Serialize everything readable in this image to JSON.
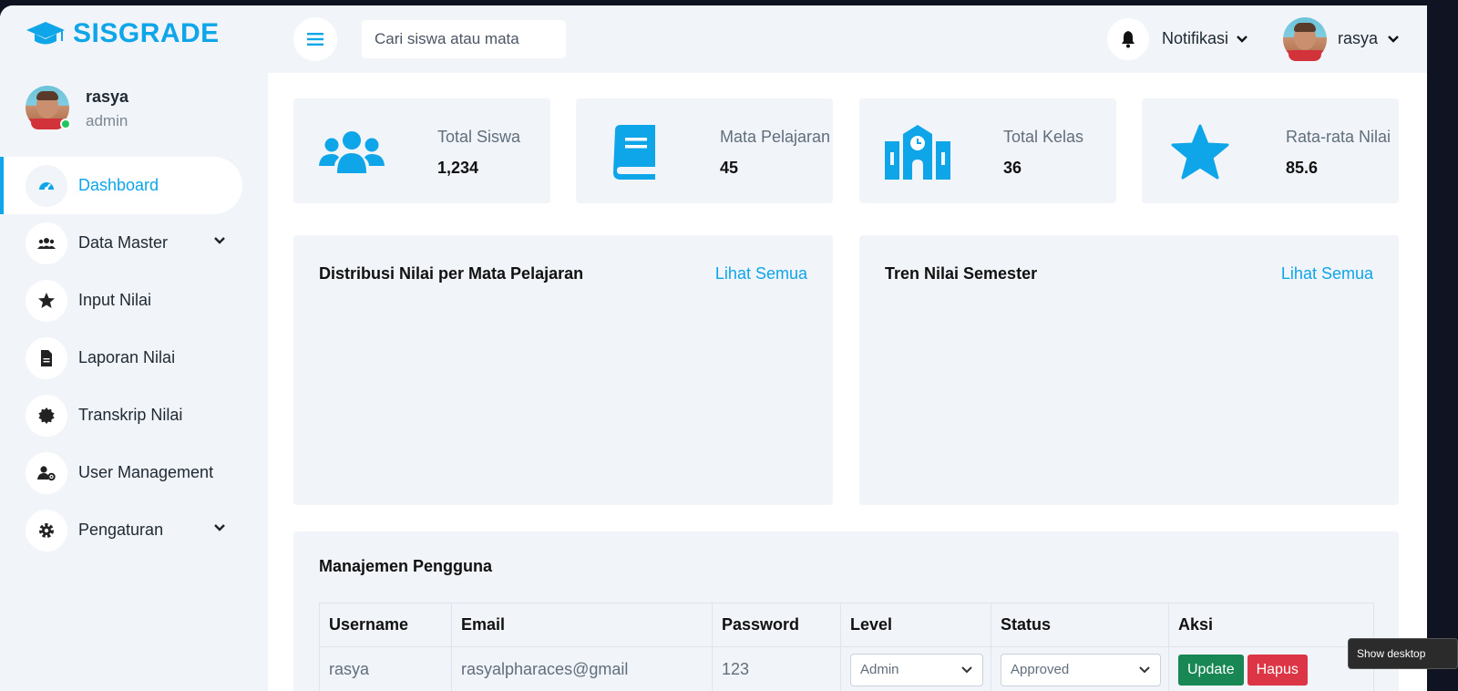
{
  "app": {
    "name": "SISGRADE",
    "accent": "#0ea5e9"
  },
  "profile": {
    "name": "rasya",
    "role": "admin",
    "status": "online"
  },
  "sidebar": {
    "items": [
      {
        "label": "Dashboard",
        "icon": "gauge-icon",
        "active": true
      },
      {
        "label": "Data Master",
        "icon": "users-icon",
        "has_submenu": true
      },
      {
        "label": "Input Nilai",
        "icon": "star-icon"
      },
      {
        "label": "Laporan Nilai",
        "icon": "file-icon"
      },
      {
        "label": "Transkrip Nilai",
        "icon": "certificate-icon"
      },
      {
        "label": "User Management",
        "icon": "user-gear-icon"
      },
      {
        "label": "Pengaturan",
        "icon": "gear-icon",
        "has_submenu": true
      }
    ]
  },
  "topbar": {
    "search_placeholder": "Cari siswa atau mata",
    "notifications_label": "Notifikasi",
    "user_label": "rasya"
  },
  "stats": [
    {
      "label": "Total Siswa",
      "value": "1,234",
      "icon": "users-icon"
    },
    {
      "label": "Mata Pelajaran",
      "value": "45",
      "icon": "book-icon"
    },
    {
      "label": "Total Kelas",
      "value": "36",
      "icon": "school-icon"
    },
    {
      "label": "Rata-rata Nilai",
      "value": "85.6",
      "icon": "star-icon"
    }
  ],
  "charts": {
    "left": {
      "title": "Distribusi Nilai per Mata Pelajaran",
      "link": "Lihat Semua"
    },
    "right": {
      "title": "Tren Nilai Semester",
      "link": "Lihat Semua"
    }
  },
  "users_section": {
    "title": "Manajemen Pengguna",
    "columns": [
      "Username",
      "Email",
      "Password",
      "Level",
      "Status",
      "Aksi"
    ],
    "rows": [
      {
        "username": "rasya",
        "email": "rasyalpharaces@gmail",
        "password": "123",
        "level": "Admin",
        "status": "Approved",
        "update_label": "Update",
        "delete_label": "Hapus"
      }
    ]
  },
  "tooltip": {
    "text": "Show desktop"
  }
}
